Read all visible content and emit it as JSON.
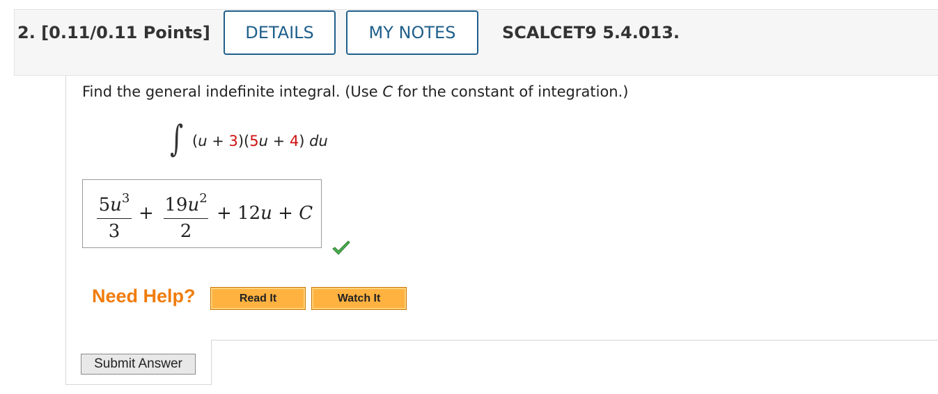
{
  "header": {
    "question_title": "2.  [0.11/0.11 Points]",
    "details_label": "DETAILS",
    "my_notes_label": "MY NOTES",
    "question_code": "SCALCET9 5.4.013."
  },
  "question": {
    "prompt_before": "Find the general indefinite integral. (Use ",
    "prompt_var": "C",
    "prompt_after": " for the constant of integration.)",
    "integral_sign": "∫",
    "integrand": {
      "p1": "(",
      "u1": "u",
      "p2": " + ",
      "c1": "3",
      "p3": ")(",
      "c2": "5",
      "u2": "u",
      "p4": " + ",
      "c3": "4",
      "p5": ") ",
      "du": "du"
    }
  },
  "answer": {
    "term1_num_coef": "5",
    "term1_num_var": "u",
    "term1_num_exp": "3",
    "term1_den": "3",
    "plus1": "+",
    "term2_num_coef": "19",
    "term2_num_var": "u",
    "term2_num_exp": "2",
    "term2_den": "2",
    "tail_plus1": "+ 12",
    "tail_var": "u",
    "tail_plus2": " + ",
    "tail_const": "C",
    "status": "correct"
  },
  "help": {
    "need_help_label": "Need Help?",
    "read_it_label": "Read It",
    "watch_it_label": "Watch It"
  },
  "actions": {
    "submit_label": "Submit Answer"
  },
  "colors": {
    "header_bg": "#f6f6f6",
    "button_blue": "#1f5f8b",
    "highlight_red": "#d01010",
    "help_orange": "#f07c0c",
    "help_button": "#ffb240",
    "check_green": "#4caf50"
  }
}
